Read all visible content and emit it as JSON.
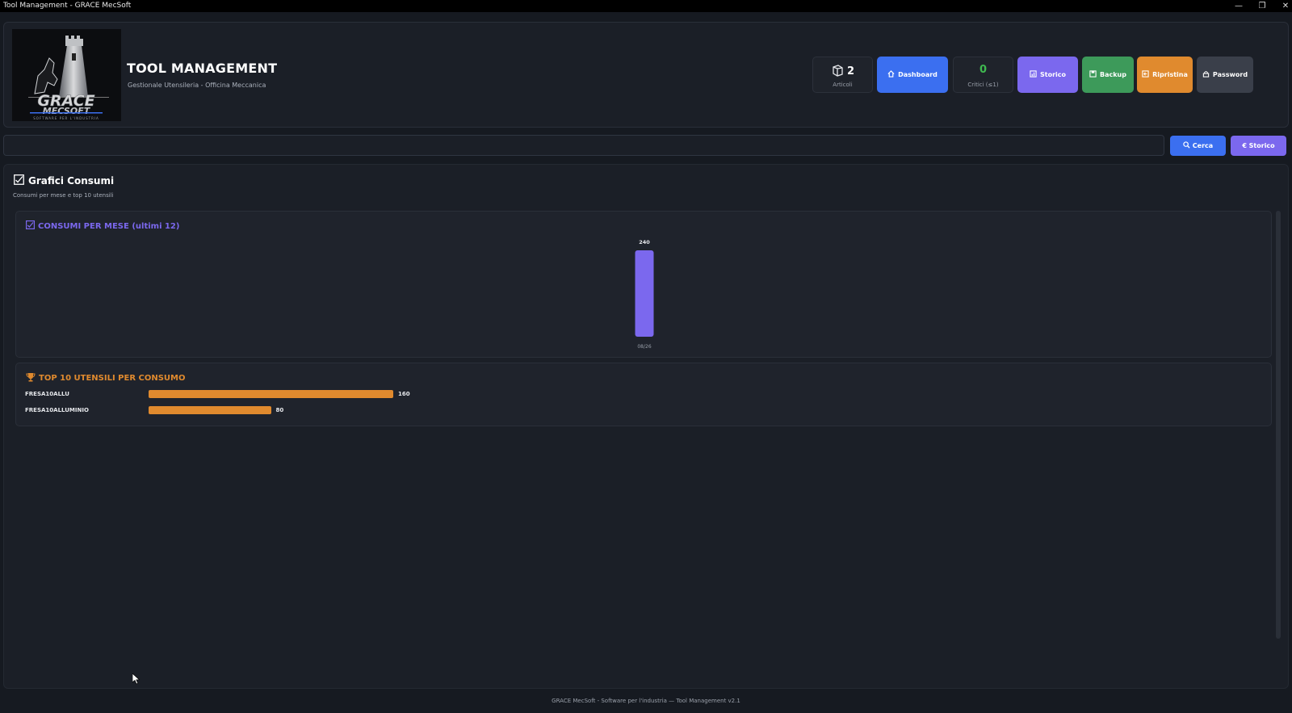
{
  "window": {
    "title": "Tool Management - GRACE MecSoft",
    "minimize": "—",
    "maximize": "❐",
    "close": "✕"
  },
  "header": {
    "title": "TOOL MANAGEMENT",
    "subtitle": "Gestionale Utensileria - Officina Meccanica",
    "logo": {
      "brand": "GRACE",
      "sub": "MECSOFT",
      "tagline": "SOFTWARE PER L'INDUSTRIA"
    },
    "stats": {
      "articoli": {
        "value": "2",
        "label": "Articoli",
        "icon": "box-icon"
      },
      "critici": {
        "value": "0",
        "label": "Critici (≤1)",
        "color": "#3fb950"
      }
    },
    "buttons": {
      "dashboard": {
        "label": "Dashboard",
        "icon": "home-icon",
        "color": "#3b6ff0"
      },
      "storico": {
        "label": "Storico",
        "icon": "chart-icon",
        "color": "#7b68ee"
      },
      "backup": {
        "label": "Backup",
        "icon": "save-icon",
        "color": "#3d9a5a"
      },
      "ripristina": {
        "label": "Ripristina",
        "icon": "restore-icon",
        "color": "#e08a2e"
      },
      "password": {
        "label": "Password",
        "icon": "lock-icon",
        "color": "#3a3f4a"
      }
    }
  },
  "search": {
    "value": "",
    "cerca_label": "Cerca",
    "storico_label": "€ Storico",
    "cerca_color": "#3b6ff0",
    "storico_color": "#7b68ee"
  },
  "panel": {
    "title": "Grafici Consumi",
    "subtitle": "Consumi per mese e top 10 utensili"
  },
  "monthly": {
    "title": "CONSUMI PER MESE (ultimi 12)",
    "color": "#7b68ee"
  },
  "top10": {
    "title": "TOP 10 UTENSILI PER CONSUMO",
    "color": "#e08a2e"
  },
  "chart_data": [
    {
      "type": "bar",
      "title": "CONSUMI PER MESE (ultimi 12)",
      "categories": [
        "08/26"
      ],
      "values": [
        240
      ],
      "value_labels": [
        "240"
      ],
      "ylim": [
        0,
        240
      ],
      "grid": false,
      "legend": "none",
      "bar_color": "#7b68ee"
    },
    {
      "type": "bar",
      "orientation": "horizontal",
      "title": "TOP 10 UTENSILI PER CONSUMO",
      "categories": [
        "FRESA10ALLU",
        "FRESA10ALLUMINIO"
      ],
      "values": [
        160,
        80
      ],
      "value_labels": [
        "160",
        "80"
      ],
      "xlim": [
        0,
        160
      ],
      "grid": false,
      "legend": "none",
      "bar_color": "#e08a2e"
    }
  ],
  "footer": {
    "text": "GRACE MecSoft - Software per l'industria — Tool Management v2.1"
  }
}
